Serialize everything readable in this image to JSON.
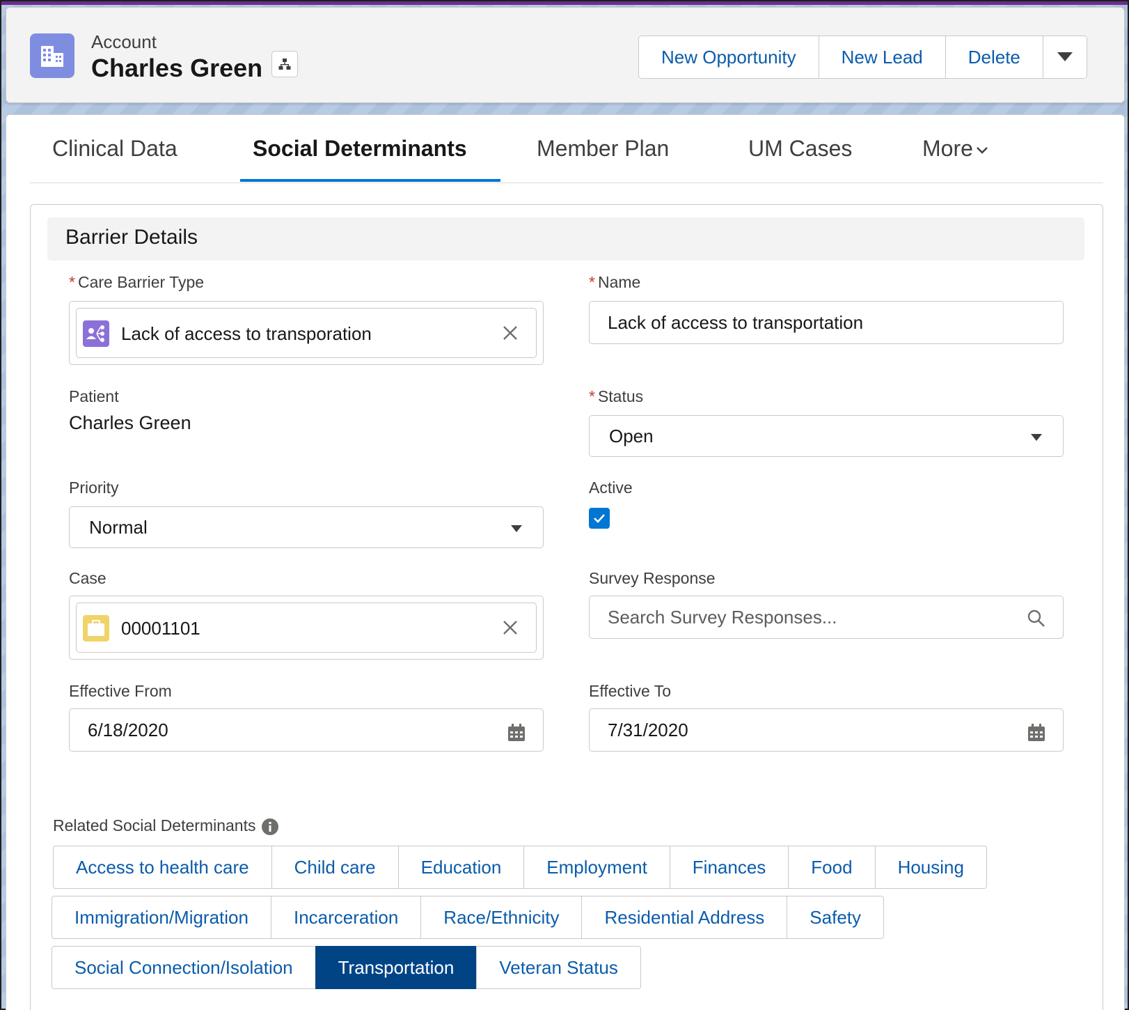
{
  "header": {
    "object_label": "Account",
    "record_name": "Charles Green",
    "actions": [
      "New Opportunity",
      "New Lead",
      "Delete"
    ]
  },
  "tabs": [
    {
      "label": "Clinical Data",
      "active": false
    },
    {
      "label": "Social Determinants",
      "active": true
    },
    {
      "label": "Member Plan",
      "active": false
    },
    {
      "label": "UM Cases",
      "active": false
    },
    {
      "label": "More",
      "active": false
    }
  ],
  "section": {
    "title": "Barrier Details"
  },
  "form": {
    "care_barrier_type": {
      "label": "Care Barrier Type",
      "required": "*",
      "value": "Lack of access to transporation"
    },
    "name": {
      "label": "Name",
      "required": "*",
      "value": "Lack of access to transportation"
    },
    "patient": {
      "label": "Patient",
      "value": "Charles Green"
    },
    "status": {
      "label": "Status",
      "required": "*",
      "value": "Open"
    },
    "priority": {
      "label": "Priority",
      "value": "Normal"
    },
    "active": {
      "label": "Active",
      "checked": true
    },
    "case": {
      "label": "Case",
      "value": "00001101"
    },
    "survey_response": {
      "label": "Survey Response",
      "placeholder": "Search Survey Responses..."
    },
    "effective_from": {
      "label": "Effective From",
      "value": "6/18/2020"
    },
    "effective_to": {
      "label": "Effective To",
      "value": "7/31/2020"
    }
  },
  "related": {
    "label": "Related Social Determinants",
    "rows": [
      [
        "Access to health care",
        "Child care",
        "Education",
        "Employment",
        "Finances",
        "Food",
        "Housing"
      ],
      [
        "Immigration/Migration",
        "Incarceration",
        "Race/Ethnicity",
        "Residential Address",
        "Safety"
      ],
      [
        "Social Connection/Isolation",
        "Transportation",
        "Veteran Status"
      ]
    ],
    "selected": "Transportation"
  },
  "colors": {
    "brand": "#0176d3",
    "link": "#0b5cab",
    "selected_chip": "#014486",
    "account_icon": "#7f8de1",
    "barrier_icon": "#8a70d8",
    "case_icon": "#f1d36b",
    "required": "#c23934"
  }
}
